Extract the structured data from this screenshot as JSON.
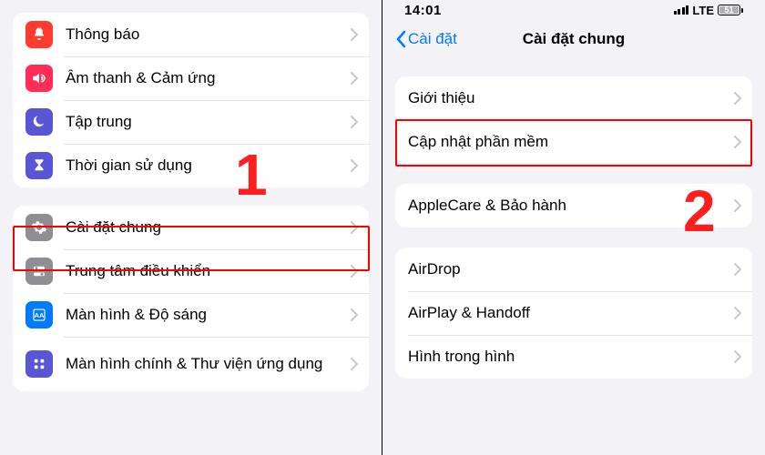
{
  "left": {
    "group1": [
      {
        "icon": "bell",
        "color": "ic-red",
        "label": "Thông báo"
      },
      {
        "icon": "speaker",
        "color": "ic-redalt",
        "label": "Âm thanh & Cảm ứng"
      },
      {
        "icon": "moon",
        "color": "ic-purple",
        "label": "Tập trung"
      },
      {
        "icon": "hourglass",
        "color": "ic-indigo",
        "label": "Thời gian sử dụng"
      }
    ],
    "group2": [
      {
        "icon": "gear",
        "color": "ic-gray",
        "label": "Cài đặt chung"
      },
      {
        "icon": "switches",
        "color": "ic-gray",
        "label": "Trung tâm điều khiển"
      },
      {
        "icon": "brightness",
        "color": "ic-blue",
        "label": "Màn hình & Độ sáng"
      },
      {
        "icon": "grid",
        "color": "ic-multi",
        "label": "Màn hình chính & Thư viện ứng dụng"
      }
    ]
  },
  "right": {
    "status": {
      "time": "14:01",
      "network": "LTE",
      "battery": "51"
    },
    "header": {
      "back": "Cài đặt",
      "title": "Cài đặt chung"
    },
    "group1": [
      {
        "label": "Giới thiệu"
      },
      {
        "label": "Cập nhật phần mềm"
      }
    ],
    "group2": [
      {
        "label": "AppleCare & Bảo hành"
      }
    ],
    "group3": [
      {
        "label": "AirDrop"
      },
      {
        "label": "AirPlay & Handoff"
      },
      {
        "label": "Hình trong hình"
      }
    ]
  },
  "annotations": {
    "step1": "1",
    "step2": "2"
  }
}
